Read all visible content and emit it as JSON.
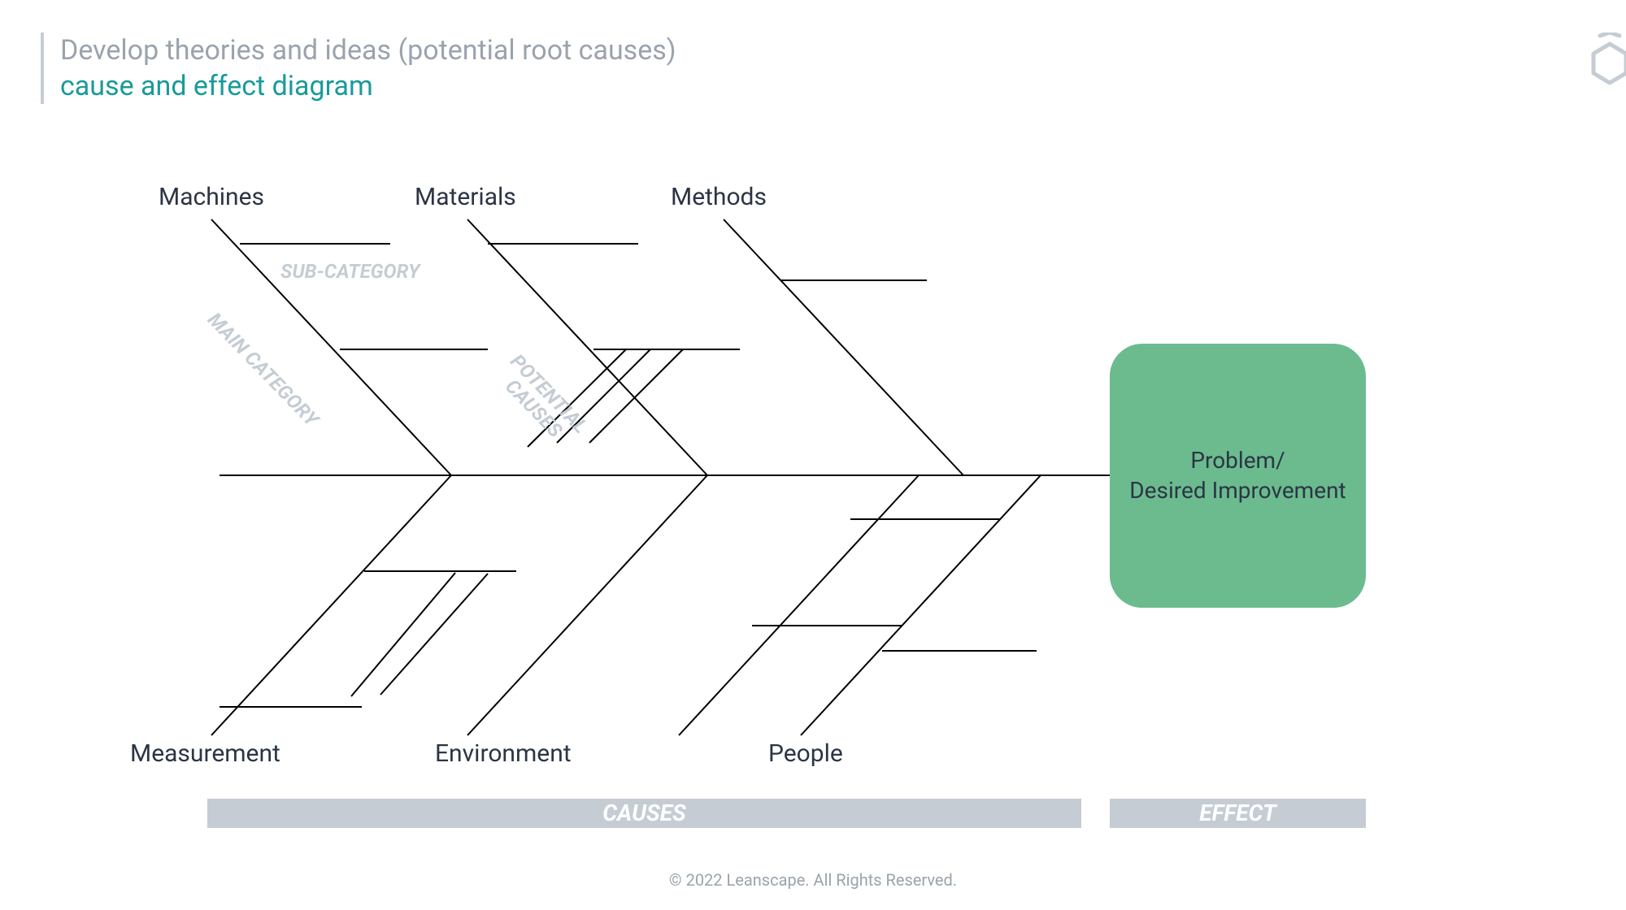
{
  "title": {
    "main": "Develop theories and ideas (potential root causes)",
    "sub": "cause and effect diagram"
  },
  "categories": {
    "top": [
      "Machines",
      "Materials",
      "Methods"
    ],
    "bottom": [
      "Measurement",
      "Environment",
      "People"
    ]
  },
  "annotations": {
    "subCategory": "SUB-CATEGORY",
    "mainCategory": "MAIN CATEGORY",
    "potentialCauses": "POTENTIAL CAUSES"
  },
  "effect": {
    "text": "Problem/\nDesired Improvement"
  },
  "sections": {
    "causes": "CAUSES",
    "effect": "EFFECT"
  },
  "footer": "© 2022 Leanscape. All Rights Reserved."
}
